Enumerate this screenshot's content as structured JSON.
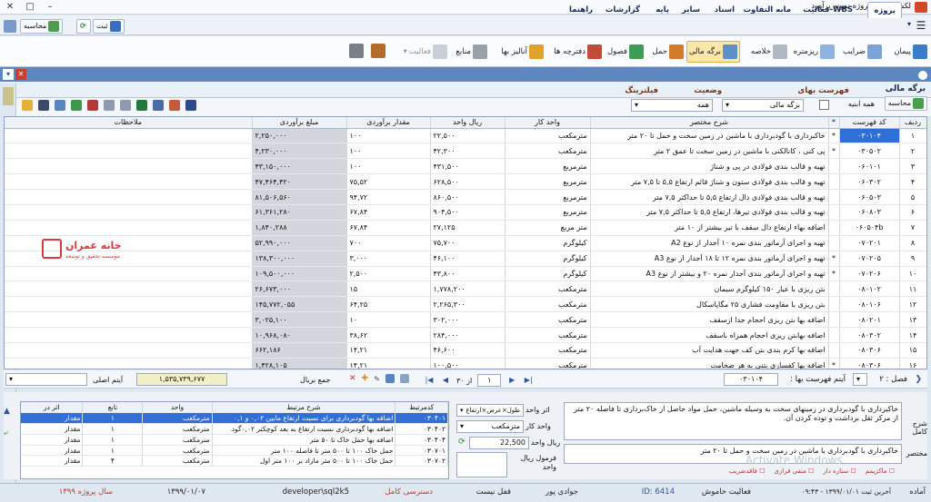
{
  "window": {
    "title": "لکسا 003 : پروژه نمونه برآورد"
  },
  "menubar": {
    "tabs": [
      "پروژه",
      "فعالیت-WBS",
      "مابه التفاوت",
      "اسناد",
      "سایر",
      "پایه",
      "گزارشات",
      "راهنما"
    ],
    "active": "پروژه"
  },
  "quick": {
    "save": "ثبت",
    "compute": "محاسبه"
  },
  "ribbon": {
    "buttons": [
      "پیمان",
      "ضرایب",
      "ریزمتره",
      "خلاصه",
      "برگه مالی",
      "حمل",
      "فصول",
      "دفترچه ها",
      "آنالیز بها",
      "منابع",
      "فعالیت"
    ],
    "selected": "برگه مالی"
  },
  "pane": {
    "title": "برگه مالی"
  },
  "filters": {
    "list_label": "فهرست بهای",
    "list_value": "همه ابنیه",
    "status_label": "وضعیت",
    "status_value": "برگه مالی",
    "filter_label": "فیلترینگ",
    "filter_value": "همه",
    "compute_btn": "محاسبه"
  },
  "grid": {
    "headers": [
      "ردیف",
      "کد فهرست",
      "*",
      "شرح مختصر",
      "واحد کار",
      "ریال واحد",
      "مقدار برآوردی",
      "مبلغ برآوردی",
      "ملاحظات"
    ],
    "rows": [
      [
        "۱",
        "۰۳۰۱۰۴",
        "*",
        "خاکبرداری با گودبرداری با ماشین در زمین سخت و حمل تا ۲۰ متر",
        "مترمکعب",
        "۲۲,۵۰۰",
        "۱۰۰",
        "۲,۲۵۰,۰۰۰",
        ""
      ],
      [
        "۲",
        "۰۳۰۵۰۲",
        "*",
        "پی کنی ، کانالکنی با ماشین در زمین سخت تا عمق ۲ متر",
        "مترمکعب",
        "۴۲,۳۰۰",
        "۱۰۰",
        "۴,۲۳۰,۰۰۰",
        ""
      ],
      [
        "۳",
        "۰۶۰۱۰۱",
        "",
        "تهیه و قالب بندی فولادی در پی و شناژ",
        "مترمربع",
        "۴۳۱,۵۰۰",
        "۱۰۰",
        "۴۳,۱۵۰,۰۰۰",
        ""
      ],
      [
        "۴",
        "۰۶۰۳۰۲",
        "",
        "تهیه و قالب بندی فولادی ستون و شناژ قائم ارتفاع ۵,۵ تا ۷,۵ متر",
        "مترمربع",
        "۶۲۸,۵۰۰",
        "۷۵,۵۲",
        "۴۷,۴۶۴,۴۲۰",
        ""
      ],
      [
        "۵",
        "۰۶۰۵۰۳",
        "",
        "تهیه و قالب بندی فولادی دال ارتفاع ۵,۵ تا حداکثر ۷,۵ متر",
        "مترمربع",
        "۸۶۰,۵۰۰",
        "۹۴,۷۲",
        "۸۱,۵۰۶,۵۶۰",
        ""
      ],
      [
        "۶",
        "۰۶۰۸۰۳",
        "",
        "تهیه و قالب بندی فولادی تیرها، ارتفاع ۵,۵ تا حداکثر ۷,۵ متر",
        "مترمربع",
        "۹۰۴,۵۰۰",
        "۶۷,۸۴",
        "۶۱,۳۶۱,۲۸۰",
        ""
      ],
      [
        "۷",
        "۰۶۰۵۰۴b",
        "",
        "اضافه بهاء ارتفاع دال سقف با تیر بیشتر از ۱۰ متر",
        "متر مربع",
        "۲۷,۱۲۵",
        "۶۷,۸۴",
        "۱,۸۴۰,۲۸۸",
        ""
      ],
      [
        "۸",
        "۰۷۰۲۰۱",
        "",
        "تهیه و اجرای آرماتور بندی نمره ۱۰ آجدار از نوع A2",
        "کیلوگرم",
        "۷۵,۷۰۰",
        "۷۰۰",
        "۵۲,۹۹۰,۰۰۰",
        ""
      ],
      [
        "۹",
        "۰۷۰۲۰۵",
        "*",
        "تهیه و اجرای آرماتور بندی نمره ۱۲ تا ۱۸ آجدار از نوع A3",
        "کیلوگرم",
        "۴۶,۱۰۰",
        "۳,۰۰۰",
        "۱۳۸,۳۰۰,۰۰۰",
        ""
      ],
      [
        "۱۰",
        "۰۷۰۲۰۶",
        "*",
        "تهیه و اجرای آرماتور بندی آجدار نمره ۲۰ و بیشتر از نوع A3",
        "کیلوگرم",
        "۴۳,۸۰۰",
        "۲,۵۰۰",
        "۱۰۹,۵۰۰,۰۰۰",
        ""
      ],
      [
        "۱۱",
        "۰۸۰۱۰۲",
        "",
        "بتن ریزی با عیار ۱۵۰ کیلوگرم سیمان",
        "مترمکعب",
        "۱,۷۷۸,۲۰۰",
        "۱۵",
        "۲۶,۶۷۳,۰۰۰",
        ""
      ],
      [
        "۱۲",
        "۰۸۰۱۰۶",
        "",
        "بتن ریزی با مقاومت فشاری ۲۵ مگاپاسکال",
        "مترمکعب",
        "۲,۲۶۵,۳۰۰",
        "۶۴,۲۵",
        "۱۴۵,۷۷۲,۰۵۵",
        ""
      ],
      [
        "۱۳",
        "۰۸۰۲۰۱",
        "",
        "اضافه بها بتن ریزی احجام جدا ازسقف",
        "مترمکعب",
        "۳۰۲,۰۰۰",
        "۱۰",
        "۳,۰۲۵,۱۰۰",
        ""
      ],
      [
        "۱۴",
        "۰۸۰۳۰۲",
        "",
        "اضافه بهابتن ریزی احجام همراه باسقف",
        "مترمکعب",
        "۲۸۴,۰۰۰",
        "۳۸,۶۲",
        "۱۰,۹۶۸,۰۸۰",
        ""
      ],
      [
        "۱۵",
        "۰۸۰۳۰۶",
        "",
        "اضافه بها کرم بندی بتن کف جهت هدایت آب",
        "مترمکعب",
        "۴۶,۶۰۰",
        "۱۴,۲۱",
        "۶۶۲,۱۸۶",
        ""
      ],
      [
        "۱۶",
        "۰۸۰۳۰۶",
        "*",
        "اضافه بها کفسازی بتنی به هر ضخامت",
        "مترمکعب",
        "۱۰۰,۵۰۰",
        "۱۴,۲۱",
        "۱,۴۲۸,۱۰۵",
        ""
      ]
    ],
    "selected_row": 0
  },
  "nav": {
    "section": "فصل : ۲",
    "item_label": "آیتم فهرست بها :",
    "item_value": "۰۳۰۱۰۴",
    "page_prefix": "از ۳۰",
    "page_num": "۱",
    "total_label": "جمع بریال",
    "total_value": "۱,۵۳۵,۷۳۹,۶۷۷",
    "main_item": "آیتم اصلی"
  },
  "sub": {
    "headers": [
      "کدمرتبط",
      "شرح مرتبط",
      "واحد",
      "تابع",
      "اثر در"
    ],
    "rows": [
      [
        "۰۳۰۴۰۱",
        "اضافه بها گودبرداری برای نسبت ارتفاع مابین ۰,۰۲ و ۰,۱",
        "مترمکعب",
        "۱",
        "مقدار"
      ],
      [
        "۰۳۰۴۰۲",
        "اضافه بها گودبرداری نسبت ارتفاع به بعد کوچکتر ۰,۰۲گود",
        "مترمکعب",
        "۱",
        "مقدار"
      ],
      [
        "۰۳۰۴۰۴",
        "اضافه بها حمل خاک تا ۵۰ متر",
        "مترمکعب",
        "۱",
        "مقدار"
      ],
      [
        "۰۳۰۷۰۱",
        "حمل خاک ۱۰۰ تا ۵۰۰ متر تا فاصله ۱۰۰ متر",
        "مترمکعب",
        "۱",
        "مقدار"
      ],
      [
        "۰۳۰۷۰۲",
        "حمل خاک ۱۰۰ تا ۵۰۰ متر مازاد بر ۱۰۰ متر اول",
        "مترمکعب",
        "۴",
        "مقدار"
      ]
    ]
  },
  "detail": {
    "full_label": "شرح کامل",
    "full_text": "خاکبرداری با گودبرداری در زمینهای سخت به وسیله ماشین، حمل مواد حاصل از خاک‌برداری تا فاصله ۲۰ متر از مرکز ثقل برداشت و توده کردن آن.",
    "short_label": "مختصر",
    "short_text": "خاکبرداری با گودبرداری با ماشین در زمین سخت و حمل تا ۲۰ متر",
    "effect_label": "اثر واحد",
    "effect_value": "طول×عرض×ارتفاع",
    "unit_label": "واحد کار",
    "unit_value": "مترمکعب",
    "price_label": "ریال واحد",
    "price_value": "22,500",
    "formula_label": "فرمول ریال واحد",
    "checks": [
      "ماکزیمم",
      "ستاره دار",
      "منفی فرازی",
      "فاقدضریب"
    ],
    "watermark": "Activate Windows"
  },
  "status": {
    "ready": "آماده",
    "last_save": "آخرین ثبت ۱۳۹۹/۰۱/۰۱ - ۰۹:۴۳",
    "activity": "فعالیت خاموش",
    "id": "ID: 6414",
    "user": "جوادی پور",
    "lock": "قفل نیست",
    "access": "دسترسی کامل",
    "server": "developer\\sql2k5",
    "date": "۱۳۹۹/۰۱/۰۷",
    "year": "سال پروژه ۱۳۹۹"
  },
  "logo": {
    "name": "خانه عمران",
    "tagline": "موسسه تحقیق و توسعه"
  },
  "colors": {
    "accent": "#2f6fd6",
    "ribbon_sel": "#fbe8a8",
    "status_red": "#c0392b"
  }
}
